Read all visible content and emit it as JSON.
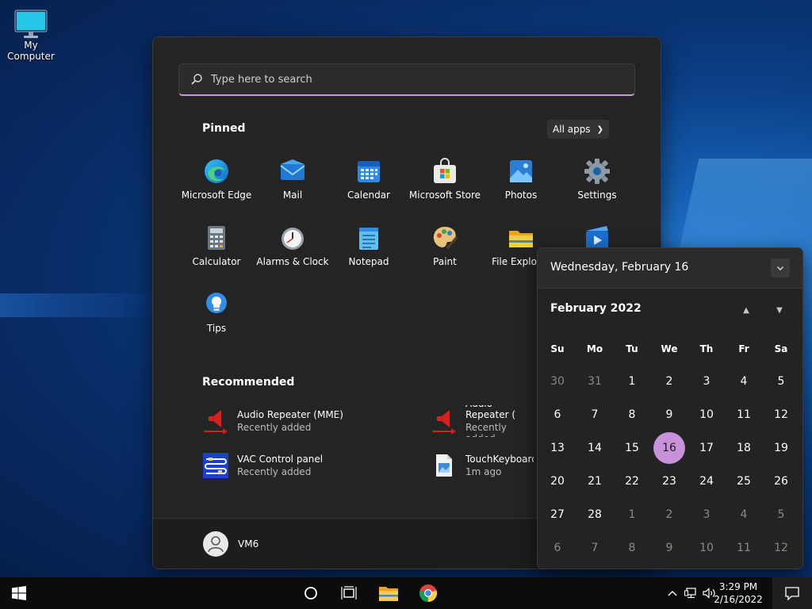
{
  "desktop": {
    "icon_label": "My Computer"
  },
  "start_menu": {
    "search_placeholder": "Type here to search",
    "pinned_title": "Pinned",
    "all_apps_label": "All apps",
    "pinned": [
      {
        "label": "Microsoft Edge",
        "icon": "edge-icon"
      },
      {
        "label": "Mail",
        "icon": "mail-icon"
      },
      {
        "label": "Calendar",
        "icon": "calendar-icon"
      },
      {
        "label": "Microsoft Store",
        "icon": "store-icon"
      },
      {
        "label": "Photos",
        "icon": "photos-icon"
      },
      {
        "label": "Settings",
        "icon": "gear-icon"
      },
      {
        "label": "Calculator",
        "icon": "calculator-icon"
      },
      {
        "label": "Alarms & Clock",
        "icon": "clock-icon"
      },
      {
        "label": "Notepad",
        "icon": "notepad-icon"
      },
      {
        "label": "Paint",
        "icon": "paint-icon"
      },
      {
        "label": "File Explorer",
        "icon": "folder-icon"
      },
      {
        "label": "",
        "icon": "media-icon"
      },
      {
        "label": "Tips",
        "icon": "lightbulb-icon"
      }
    ],
    "recommended_title": "Recommended",
    "recommended": [
      {
        "title": "Audio Repeater (MME)",
        "subtitle": "Recently added",
        "icon": "audio-repeater-icon"
      },
      {
        "title": "Audio Repeater (",
        "subtitle": "Recently added",
        "icon": "audio-repeater-icon"
      },
      {
        "title": "VAC Control panel",
        "subtitle": "Recently added",
        "icon": "vac-icon"
      },
      {
        "title": "TouchKeyboardT",
        "subtitle": "1m ago",
        "icon": "image-file-icon"
      }
    ],
    "user_name": "VM6"
  },
  "calendar": {
    "full_date": "Wednesday, February 16",
    "month_label": "February 2022",
    "weekdays": [
      "Su",
      "Mo",
      "Tu",
      "We",
      "Th",
      "Fr",
      "Sa"
    ],
    "weeks": [
      [
        "30",
        "31",
        "1",
        "2",
        "3",
        "4",
        "5"
      ],
      [
        "6",
        "7",
        "8",
        "9",
        "10",
        "11",
        "12"
      ],
      [
        "13",
        "14",
        "15",
        "16",
        "17",
        "18",
        "19"
      ],
      [
        "20",
        "21",
        "22",
        "23",
        "24",
        "25",
        "26"
      ],
      [
        "27",
        "28",
        "1",
        "2",
        "3",
        "4",
        "5"
      ],
      [
        "6",
        "7",
        "8",
        "9",
        "10",
        "11",
        "12"
      ]
    ],
    "today": "16",
    "accent_color": "#c792d9"
  },
  "taskbar": {
    "time": "3:29 PM",
    "date": "2/16/2022"
  }
}
